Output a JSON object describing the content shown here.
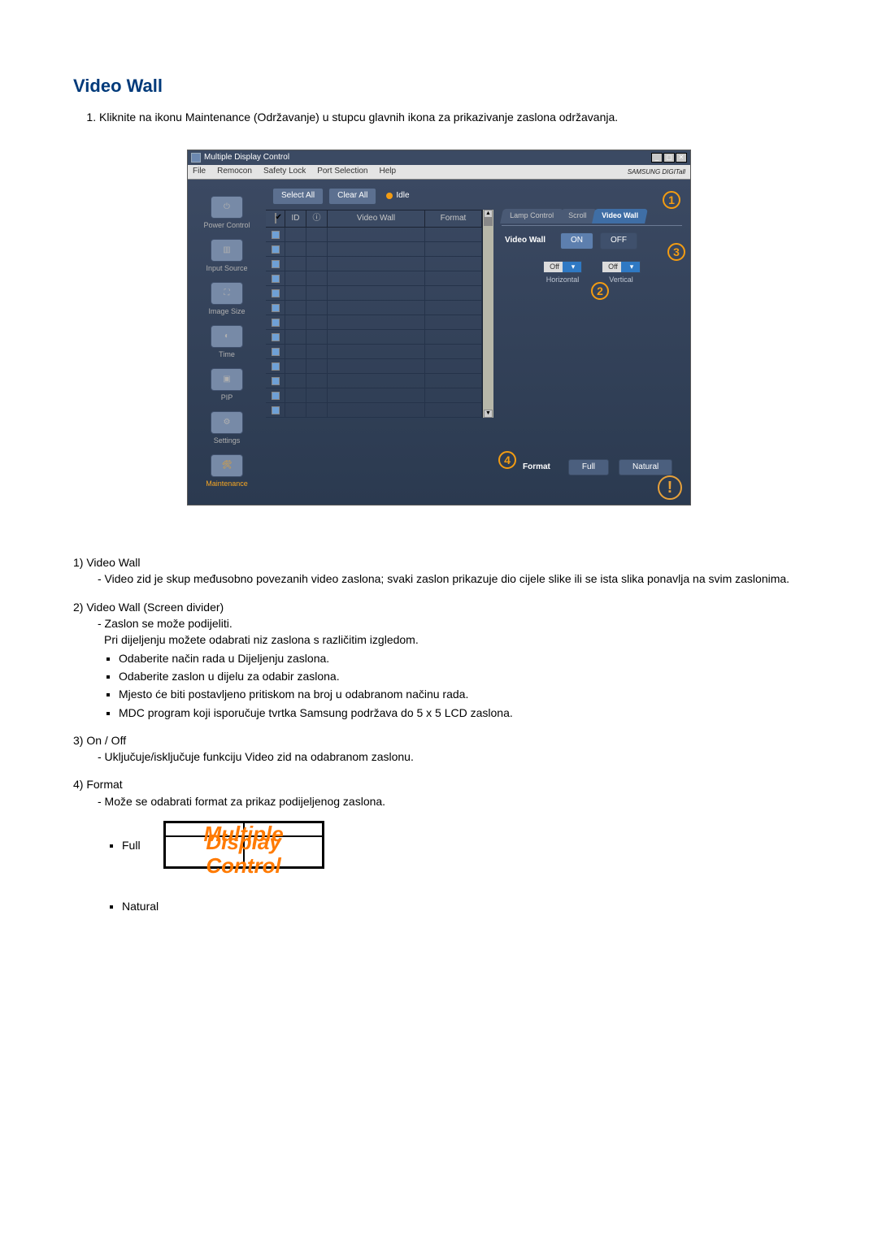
{
  "page": {
    "title": "Video Wall",
    "intro_num": "1.",
    "intro_text": "Kliknite na ikonu Maintenance (Održavanje) u stupcu glavnih ikona za prikazivanje zaslona održavanja."
  },
  "app": {
    "window_title": "Multiple Display Control",
    "brand": "SAMSUNG DIGITall",
    "menus": [
      "File",
      "Remocon",
      "Safety Lock",
      "Port Selection",
      "Help"
    ],
    "win_controls": {
      "min": "_",
      "max": "▢",
      "close": "✕"
    },
    "toolbar": {
      "select_all": "Select All",
      "clear_all": "Clear All",
      "idle": "Idle"
    },
    "grid": {
      "chk_head": "✔",
      "id_head": "ID",
      "info_head": "ⓘ",
      "col_vw": "Video Wall",
      "col_fmt": "Format",
      "scroll_up": "▲",
      "scroll_down": "▼"
    },
    "sidenav": [
      {
        "label": "Power Control"
      },
      {
        "label": "Input Source"
      },
      {
        "label": "Image Size"
      },
      {
        "label": "Time"
      },
      {
        "label": "PIP"
      },
      {
        "label": "Settings"
      },
      {
        "label": "Maintenance",
        "active": true
      }
    ],
    "tabs": {
      "lamp": "Lamp Control",
      "scroll": "Scroll",
      "vw": "Video Wall"
    },
    "panel": {
      "vw_label": "Video Wall",
      "on": "ON",
      "off": "OFF",
      "h_value": "Off",
      "h_label": "Horizontal",
      "v_value": "Off",
      "v_label": "Vertical"
    },
    "format": {
      "label": "Format",
      "full": "Full",
      "natural": "Natural"
    },
    "callouts": {
      "c1": "1",
      "c2": "2",
      "c3": "3",
      "c4": "4"
    }
  },
  "desc": {
    "d1_head": "1) Video Wall",
    "d1_line": "- Video zid je skup međusobno povezanih video zaslona; svaki zaslon prikazuje dio cijele slike ili se ista slika ponavlja na svim zaslonima.",
    "d2_head": "2) Video Wall (Screen divider)",
    "d2_line1": "- Zaslon se može podijeliti.",
    "d2_line2": "Pri dijeljenju možete odabrati niz zaslona s različitim izgledom.",
    "d2_li": [
      "Odaberite način rada u Dijeljenju zaslona.",
      "Odaberite zaslon u dijelu za odabir zaslona.",
      "Mjesto će biti postavljeno pritiskom na broj u odabranom načinu rada.",
      "MDC program koji isporučuje tvrtka Samsung podržava do 5 x 5 LCD zaslona."
    ],
    "d3_head": "3) On / Off",
    "d3_line": "- Uključuje/isključuje funkciju Video zid na odabranom zaslonu.",
    "d4_head": "4) Format",
    "d4_line": "- Može se odabrati format za prikaz podijeljenog zaslona.",
    "full_bullet": "Full",
    "natural_bullet": "Natural",
    "mdc_text": {
      "l1": "Multiple",
      "l2": "Display",
      "l3": "Control"
    }
  }
}
